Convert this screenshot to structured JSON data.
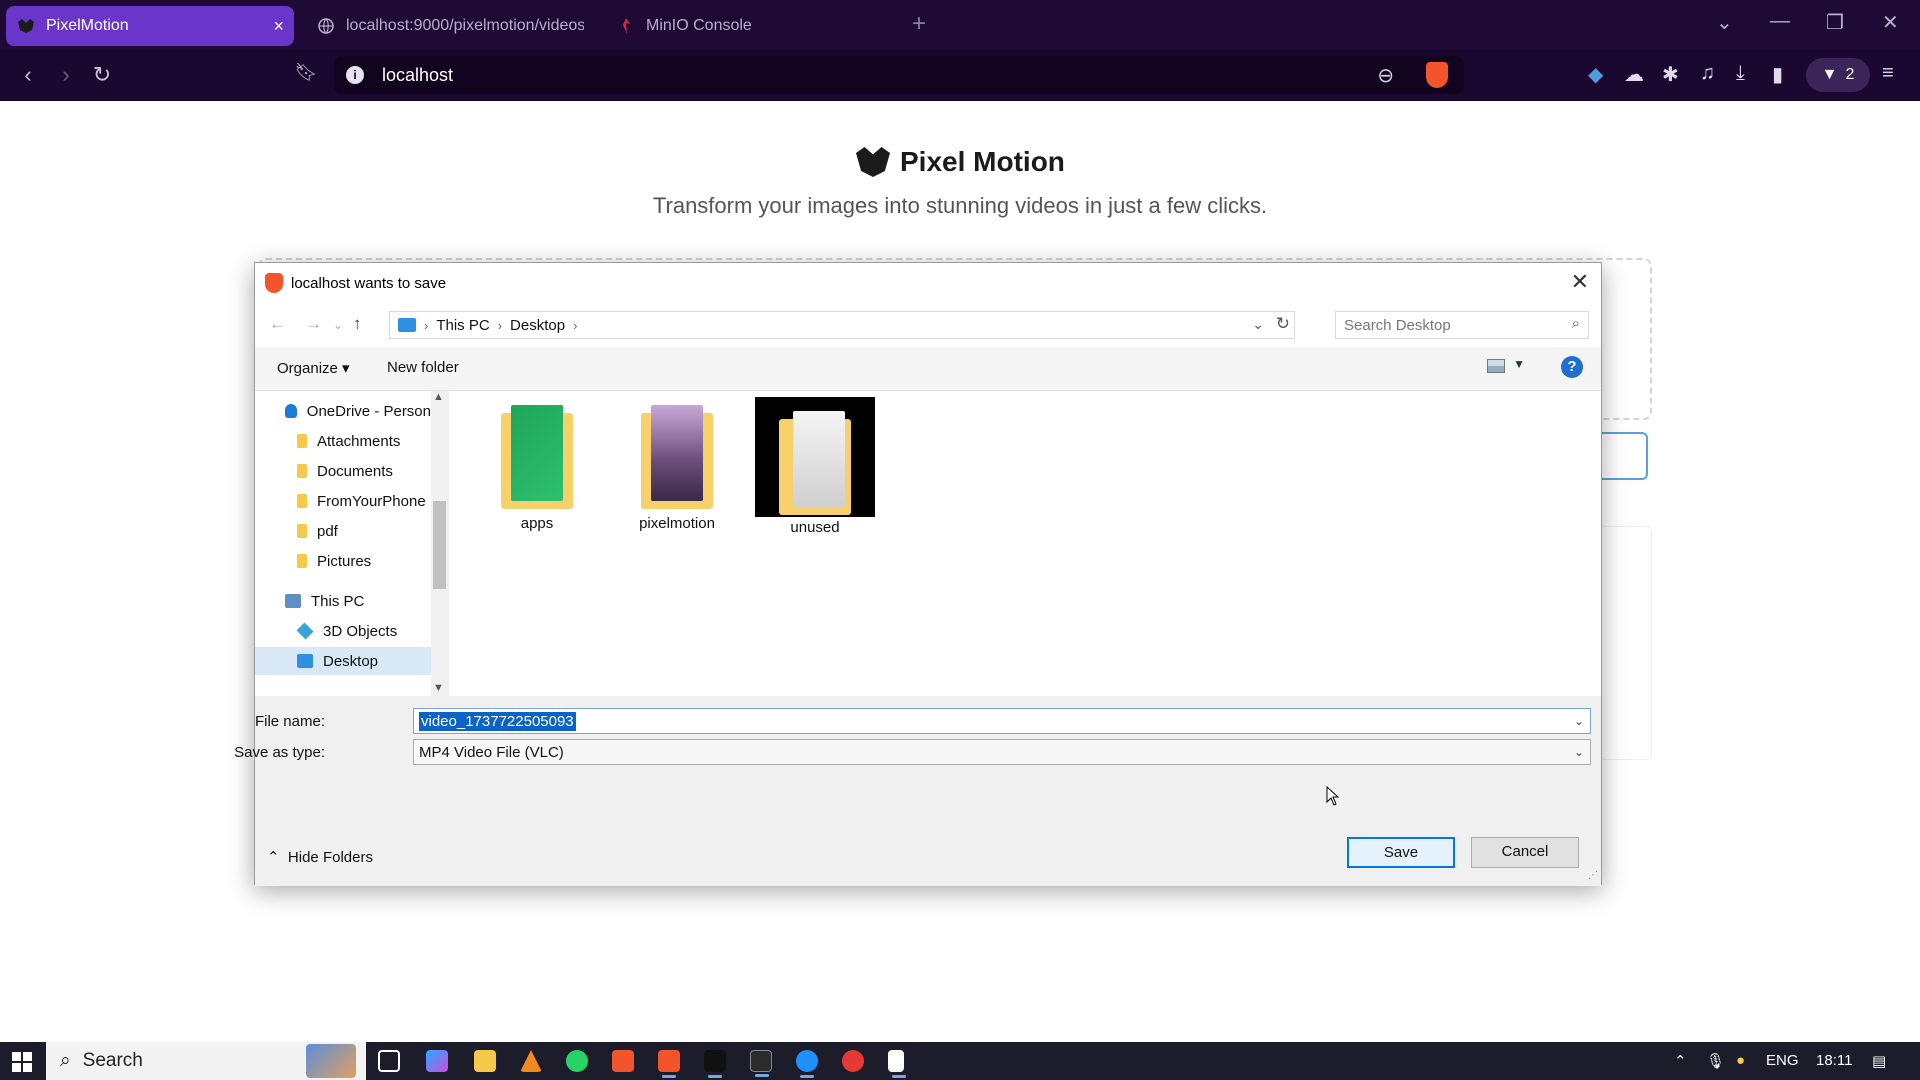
{
  "browser": {
    "tabs": [
      {
        "label": "PixelMotion",
        "active": true
      },
      {
        "label": "localhost:9000/pixelmotion/videos/",
        "active": false
      },
      {
        "label": "MinIO Console",
        "active": false
      }
    ],
    "url": "localhost",
    "wallet_count": "2",
    "accent_color": "#6a35c9"
  },
  "page": {
    "brand": "Pixel Motion",
    "tagline": "Transform your images into stunning videos in just a few clicks."
  },
  "dialog": {
    "title": "localhost wants to save",
    "breadcrumb": [
      "This PC",
      "Desktop"
    ],
    "search_placeholder": "Search Desktop",
    "organize": "Organize",
    "new_folder": "New folder",
    "nav_items": [
      {
        "label": "OneDrive - Person",
        "icon": "cloud-icon"
      },
      {
        "label": "Attachments",
        "icon": "folder-icon"
      },
      {
        "label": "Documents",
        "icon": "folder-icon"
      },
      {
        "label": "FromYourPhone",
        "icon": "folder-icon"
      },
      {
        "label": "pdf",
        "icon": "folder-icon"
      },
      {
        "label": "Pictures",
        "icon": "folder-icon"
      },
      {
        "label": "This PC",
        "icon": "computer-icon"
      },
      {
        "label": "3D Objects",
        "icon": "cube-icon"
      },
      {
        "label": "Desktop",
        "icon": "desktop-icon",
        "selected": true
      }
    ],
    "folders": [
      {
        "label": "apps"
      },
      {
        "label": "pixelmotion"
      },
      {
        "label": "unused",
        "selected": true
      }
    ],
    "file_name_label": "File name:",
    "file_name_value": "video_1737722505093",
    "save_type_label": "Save as type:",
    "save_type_value": "MP4 Video File (VLC)",
    "hide_folders": "Hide Folders",
    "save": "Save",
    "cancel": "Cancel"
  },
  "taskbar": {
    "search": "Search",
    "language": "ENG",
    "time": "18:11"
  }
}
